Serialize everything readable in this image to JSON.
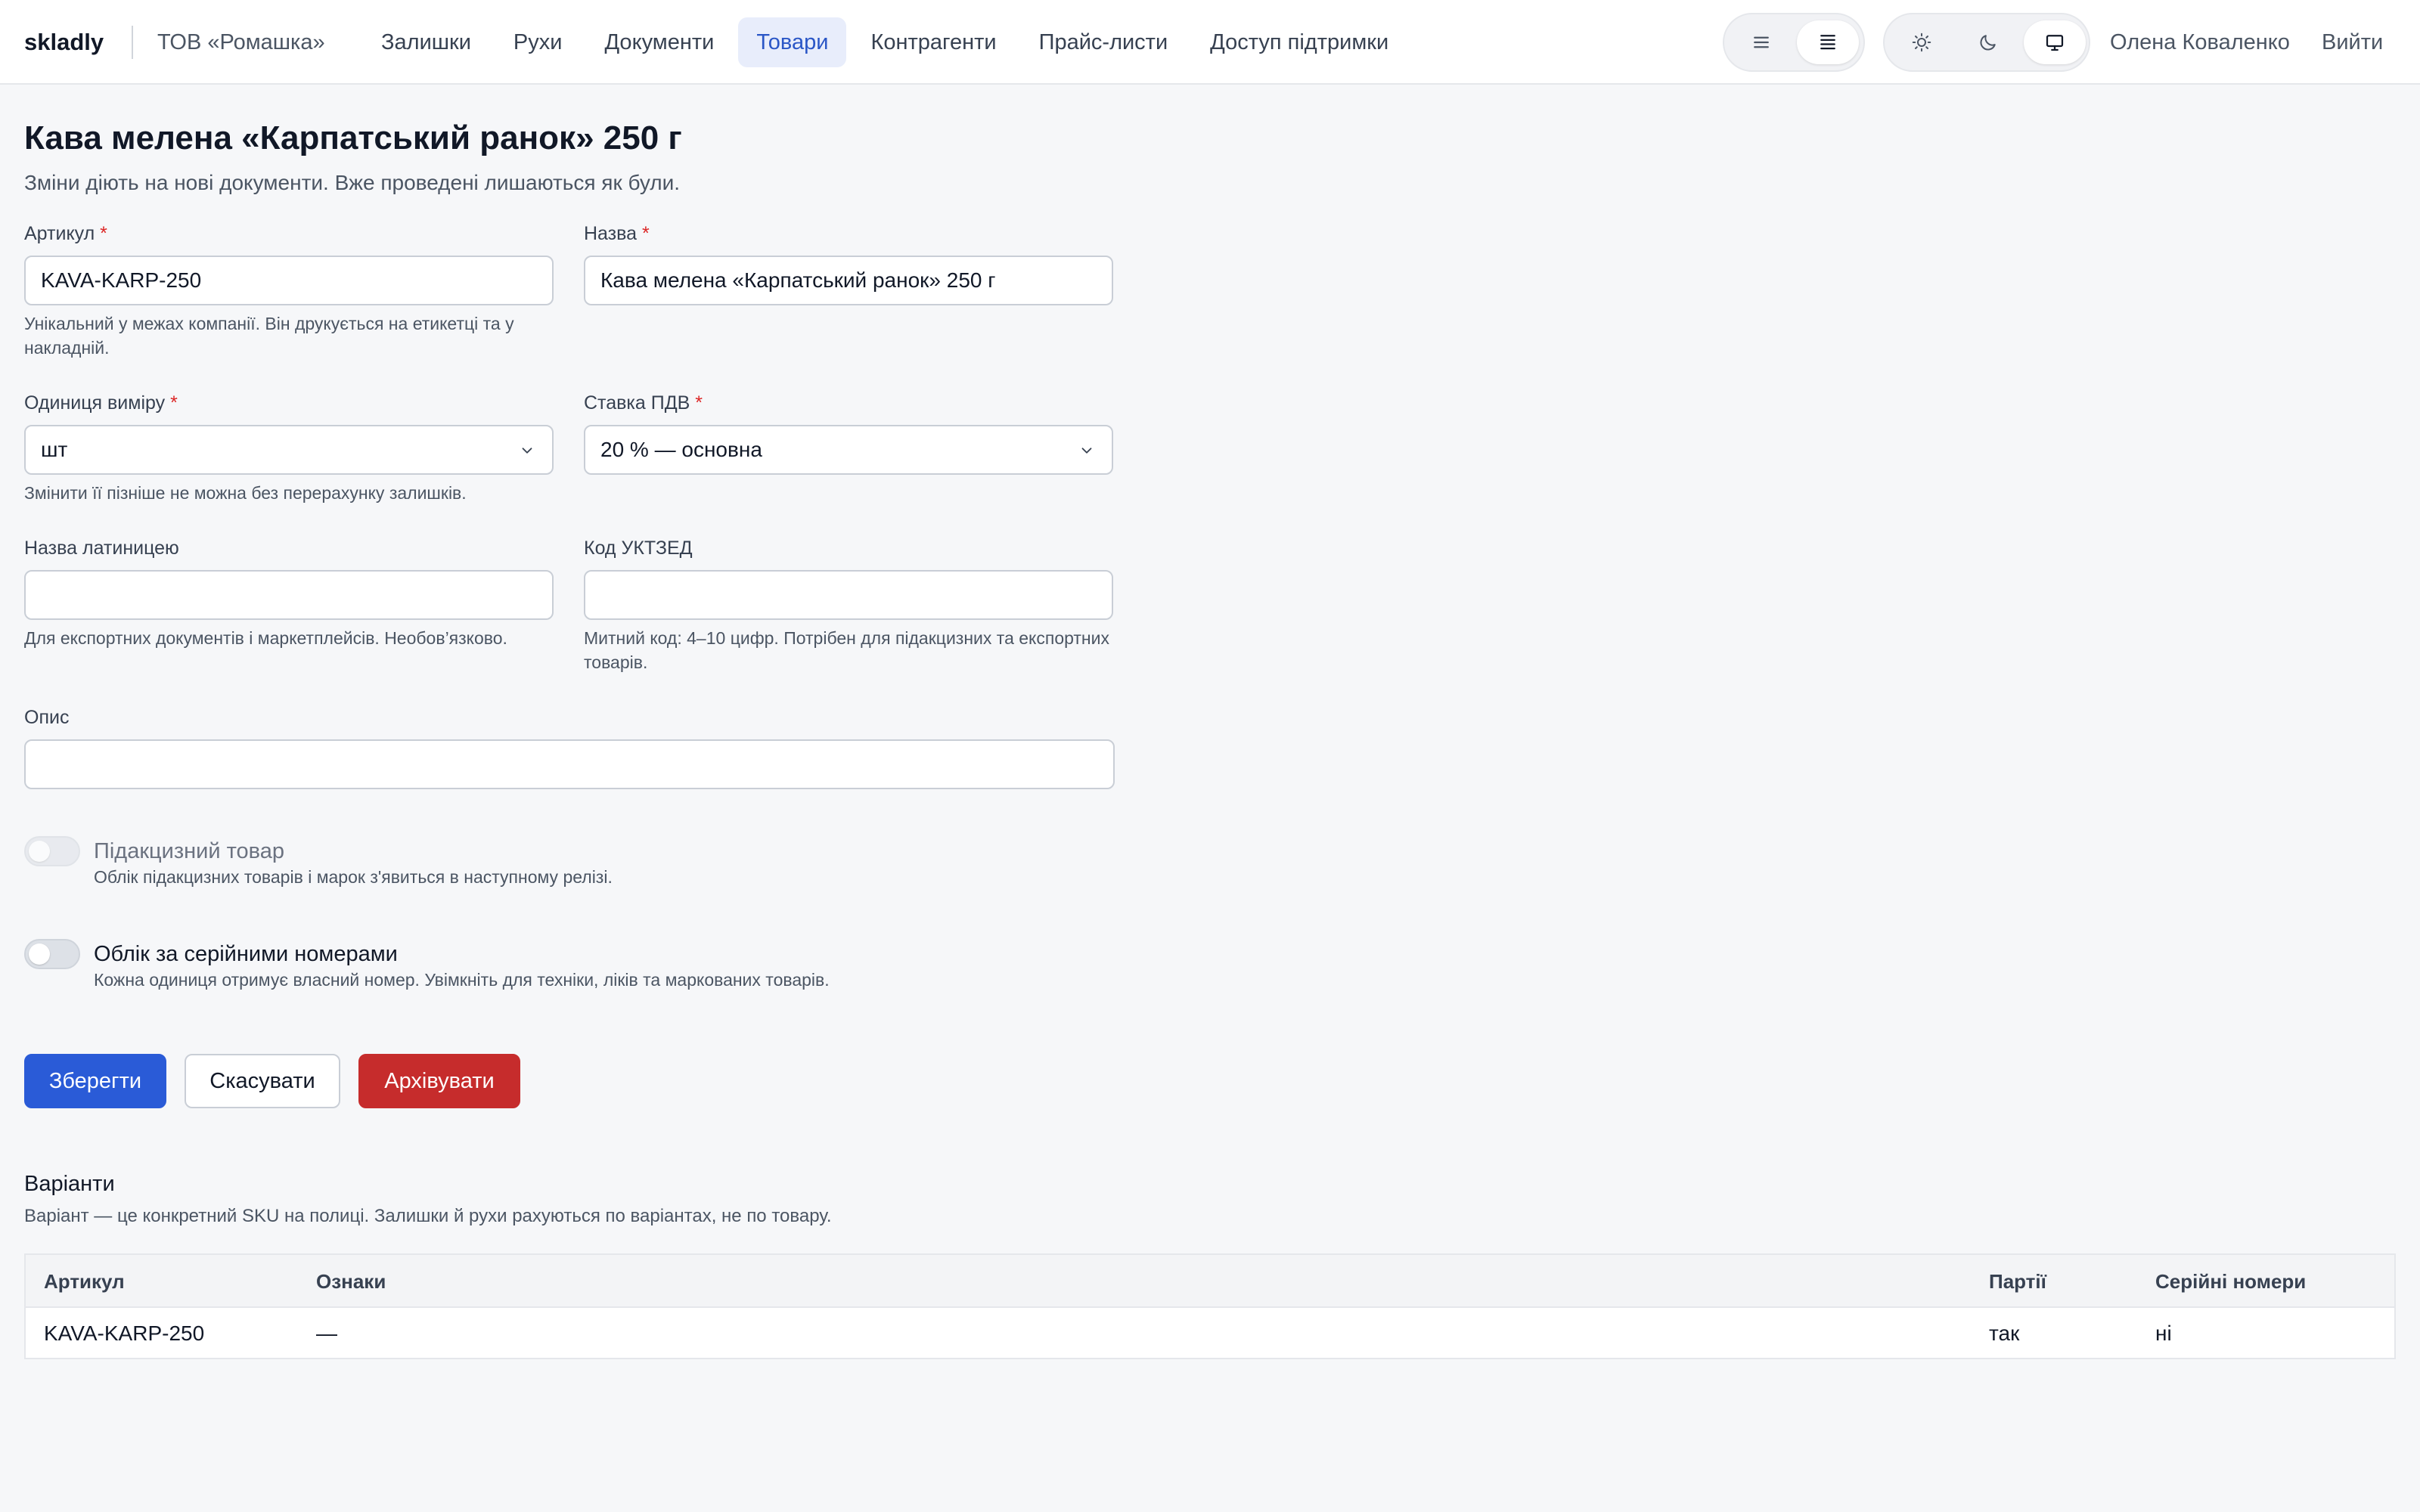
{
  "header": {
    "logo": "skladly",
    "company": "ТОВ «Ромашка»",
    "nav": [
      {
        "label": "Залишки",
        "active": false
      },
      {
        "label": "Рухи",
        "active": false
      },
      {
        "label": "Документи",
        "active": false
      },
      {
        "label": "Товари",
        "active": true
      },
      {
        "label": "Контрагенти",
        "active": false
      },
      {
        "label": "Прайс-листи",
        "active": false
      },
      {
        "label": "Доступ підтримки",
        "active": false
      }
    ],
    "density_toggle": {
      "options": [
        "list-comfortable-icon",
        "list-compact-icon"
      ],
      "selected": "list-compact-icon"
    },
    "theme_toggle": {
      "options": [
        "sun-icon",
        "moon-icon",
        "monitor-icon"
      ],
      "selected": "monitor-icon"
    },
    "user_name": "Олена Коваленко",
    "logout": "Вийти"
  },
  "form": {
    "title": "Кава мелена «Карпатський ранок» 250 г",
    "subtitle": "Зміни діють на нові документи. Вже проведені лишаються як були.",
    "sku": {
      "label": "Артикул",
      "required_mark": "*",
      "value": "KAVA-KARP-250",
      "help": "Унікальний у межах компанії. Він друкується на етикетці та у накладній."
    },
    "name": {
      "label": "Назва",
      "required_mark": "*",
      "value": "Кава мелена «Карпатський ранок» 250 г"
    },
    "unit": {
      "label": "Одиниця виміру",
      "required_mark": "*",
      "value": "шт",
      "help": "Змінити її пізніше не можна без перерахунку залишків."
    },
    "vat": {
      "label": "Ставка ПДВ",
      "required_mark": "*",
      "value": "20 % — основна"
    },
    "latin_name": {
      "label": "Назва латиницею",
      "value": "",
      "help": "Для експортних документів і маркетплейсів. Необов’язково."
    },
    "uktzed": {
      "label": "Код УКТЗЕД",
      "value": "",
      "help": "Митний код: 4–10 цифр. Потрібен для підакцизних та експортних товарів."
    },
    "description": {
      "label": "Опис",
      "value": ""
    },
    "excise": {
      "label": "Підакцизний товар",
      "help": "Облік підакцизних товарів і марок з'явиться в наступному релізі.",
      "checked": false,
      "disabled": true
    },
    "serials": {
      "label": "Облік за серійними номерами",
      "help": "Кожна одиниця отримує власний номер. Увімкніть для техніки, ліків та маркованих товарів.",
      "checked": false,
      "disabled": false
    },
    "actions": {
      "save": "Зберегти",
      "cancel": "Скасувати",
      "archive": "Архівувати"
    }
  },
  "variants": {
    "title": "Варіанти",
    "subtitle": "Варіант — це конкретний SKU на полиці. Залишки й рухи рахуються по варіантах, не по товару.",
    "columns": [
      "Артикул",
      "Ознаки",
      "Партії",
      "Серійні номери"
    ],
    "rows": [
      [
        "KAVA-KARP-250",
        "—",
        "так",
        "ні"
      ]
    ]
  },
  "colors": {
    "primary": "#2a5bd7",
    "danger": "#c62c2c",
    "nav_active_bg": "#e8edfb",
    "nav_active_text": "#2a56c6",
    "required": "#dc2626"
  }
}
